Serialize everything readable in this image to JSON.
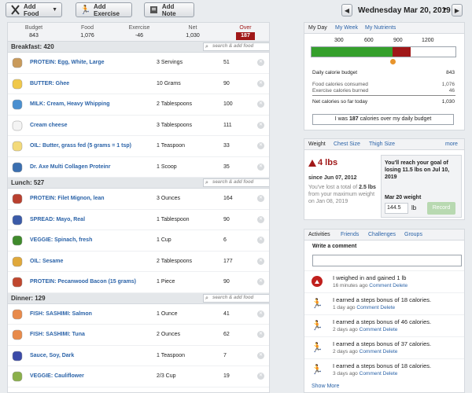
{
  "toolbar": {
    "add_food": "Add Food",
    "add_exercise": "Add Exercise",
    "add_note": "Add Note",
    "date": "Wednesday Mar 20, 2019"
  },
  "summary": {
    "budget_label": "Budget",
    "budget": "843",
    "food_label": "Food",
    "food": "1,076",
    "exercise_label": "Exercise",
    "exercise": "-46",
    "net_label": "Net",
    "net": "1,030",
    "over_label": "Over",
    "over": "187"
  },
  "search_placeholder": "search & add food",
  "meals": [
    {
      "title": "Breakfast: 420",
      "items": [
        {
          "name": "PROTEIN: Egg, White, Large",
          "qty": "3 Servings",
          "cal": "51",
          "icon": "egg-icon",
          "color": "#c99a5a"
        },
        {
          "name": "BUTTER: Ghee",
          "qty": "10 Grams",
          "cal": "90",
          "icon": "ghee-icon",
          "color": "#f0c84a"
        },
        {
          "name": "MILK: Cream, Heavy Whipping",
          "qty": "2 Tablespoons",
          "cal": "100",
          "icon": "milk-carton-icon",
          "color": "#4a8fd0"
        },
        {
          "name": "Cream cheese",
          "qty": "3 Tablespoons",
          "cal": "111",
          "icon": "cream-cheese-icon",
          "color": "#f4f4f4"
        },
        {
          "name": "OIL: Butter, grass fed (5 grams = 1 tsp)",
          "qty": "1 Teaspoon",
          "cal": "33",
          "icon": "butter-icon",
          "color": "#f3da7a"
        },
        {
          "name": "Dr. Axe Multi Collagen Proteinr",
          "qty": "1 Scoop",
          "cal": "35",
          "icon": "utensils-icon",
          "color": "#3a6fb0"
        }
      ]
    },
    {
      "title": "Lunch: 527",
      "items": [
        {
          "name": "PROTEIN: Filet Mignon, lean",
          "qty": "3 Ounces",
          "cal": "164",
          "icon": "steak-icon",
          "color": "#b9402f"
        },
        {
          "name": "SPREAD: Mayo, Real",
          "qty": "1 Tablespoon",
          "cal": "90",
          "icon": "mayo-jar-icon",
          "color": "#3b5ba8"
        },
        {
          "name": "VEGGIE: Spinach, fresh",
          "qty": "1 Cup",
          "cal": "6",
          "icon": "spinach-icon",
          "color": "#3f8a2c"
        },
        {
          "name": "OIL: Sesame",
          "qty": "2 Tablespoons",
          "cal": "177",
          "icon": "oil-bottle-icon",
          "color": "#e0a83a"
        },
        {
          "name": "PROTEIN: Pecanwood Bacon (15 grams)",
          "qty": "1 Piece",
          "cal": "90",
          "icon": "bacon-icon",
          "color": "#c0472e"
        }
      ]
    },
    {
      "title": "Dinner: 129",
      "items": [
        {
          "name": "FISH: SASHIMI: Salmon",
          "qty": "1 Ounce",
          "cal": "41",
          "icon": "shrimp-icon",
          "color": "#e88a4a"
        },
        {
          "name": "FISH: SASHIMI: Tuna",
          "qty": "2 Ounces",
          "cal": "62",
          "icon": "shrimp-icon",
          "color": "#e88a4a"
        },
        {
          "name": "Sauce, Soy, Dark",
          "qty": "1 Teaspoon",
          "cal": "7",
          "icon": "soy-sauce-icon",
          "color": "#3b4aa8"
        },
        {
          "name": "VEGGIE: Cauliflower",
          "qty": "2/3 Cup",
          "cal": "19",
          "icon": "cauliflower-icon",
          "color": "#8ab04a"
        }
      ]
    }
  ],
  "day_panel": {
    "tabs": [
      "My Day",
      "My Week",
      "My Nutrients"
    ],
    "scale": [
      "300",
      "600",
      "900",
      "1200"
    ],
    "progress": {
      "max": 1500,
      "budget": 843,
      "net": 1030
    },
    "daily_budget_label": "Daily calorie budget",
    "daily_budget": "843",
    "food_consumed_label": "Food calories consumed",
    "food_consumed": "1,076",
    "exercise_burned_label": "Exercise calories burned",
    "exercise_burned": "46",
    "net_label": "Net calories so far today",
    "net": "1,030",
    "over_prefix": "I was ",
    "over_value": "187",
    "over_suffix": " calories over my daily budget"
  },
  "weight_panel": {
    "tabs": [
      "Weight",
      "Chest Size",
      "Thigh Size"
    ],
    "more": "more",
    "change": "4 lbs",
    "since": "since Jun 07, 2012",
    "note_1": "You've lost a total of ",
    "note_lost": "2.5",
    "note_2": " lbs",
    "note_3": " from your maximum weight on Jan 08, 2019",
    "goal": "You'll reach your goal of losing 11.5 lbs on Jul 10, 2019",
    "date_label": "Mar 20 weight",
    "input_value": "144.5",
    "unit": "lb",
    "record": "Record"
  },
  "activity_panel": {
    "tabs": [
      "Activities",
      "Friends",
      "Challenges",
      "Groups"
    ],
    "comment_label": "Write a comment",
    "items": [
      {
        "text": "I weighed in and gained 1 lb",
        "time": "16 minutes ago",
        "icon": "weight-up-icon"
      },
      {
        "text": "I earned a steps bonus of 18 calories.",
        "time": "1 day ago",
        "icon": "runner-icon"
      },
      {
        "text": "I earned a steps bonus of 46 calories.",
        "time": "2 days ago",
        "icon": "runner-icon"
      },
      {
        "text": "I earned a steps bonus of 37 calories.",
        "time": "2 days ago",
        "icon": "runner-icon"
      },
      {
        "text": "I earned a steps bonus of 18 calories.",
        "time": "3 days ago",
        "icon": "runner-icon"
      }
    ],
    "comment_link": "Comment",
    "delete_link": "Delete",
    "show_more": "Show More"
  }
}
